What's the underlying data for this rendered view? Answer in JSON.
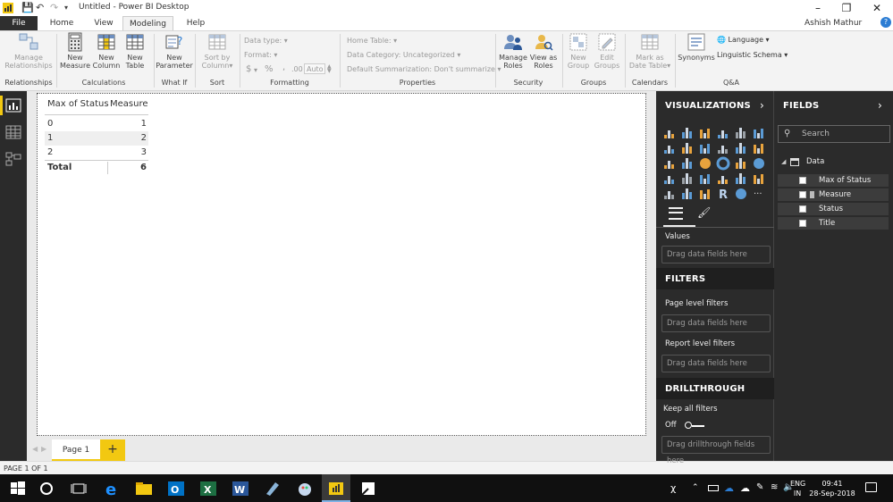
{
  "window": {
    "title": "Untitled - Power BI Desktop",
    "user": "Ashish Mathur"
  },
  "tabs": [
    {
      "label": "File"
    },
    {
      "label": "Home"
    },
    {
      "label": "View"
    },
    {
      "label": "Modeling"
    },
    {
      "label": "Help"
    }
  ],
  "ribbon": {
    "manage_relationships": "Manage\nRelationships",
    "manage_rel_1": "Manage",
    "manage_rel_2": "Relationships",
    "new_measure_1": "New",
    "new_measure_2": "Measure",
    "new_column_1": "New",
    "new_column_2": "Column",
    "new_table_1": "New",
    "new_table_2": "Table",
    "new_parameter_1": "New",
    "new_parameter_2": "Parameter",
    "sort_by_1": "Sort by",
    "sort_by_2": "Column",
    "data_type": "Data type:",
    "format": "Format:",
    "dollar": "$",
    "percent": "%",
    "comma": ",",
    "auto": "Auto",
    "home_table": "Home Table:",
    "data_category": "Data Category: Uncategorized",
    "default_summarization": "Default Summarization: Don't summarize",
    "manage_roles_1": "Manage",
    "manage_roles_2": "Roles",
    "view_as_1": "View as",
    "view_as_2": "Roles",
    "new_group_1": "New",
    "new_group_2": "Group",
    "edit_groups_1": "Edit",
    "edit_groups_2": "Groups",
    "mark_date_1": "Mark as",
    "mark_date_2": "Date Table",
    "synonyms": "Synonyms",
    "language": "Language",
    "linguistic_schema": "Linguistic Schema",
    "groups": {
      "relationships": "Relationships",
      "calculations": "Calculations",
      "what_if": "What If",
      "sort": "Sort",
      "formatting": "Formatting",
      "properties": "Properties",
      "security": "Security",
      "groups": "Groups",
      "calendars": "Calendars",
      "qa": "Q&A"
    }
  },
  "table": {
    "headers": [
      "Max of Status",
      "Measure"
    ],
    "rows": [
      [
        "0",
        "1"
      ],
      [
        "1",
        "2"
      ],
      [
        "2",
        "3"
      ]
    ],
    "total_label": "Total",
    "total_value": "6"
  },
  "pages": {
    "tab": "Page 1",
    "add": "+",
    "status": "PAGE 1 OF 1"
  },
  "visualizations": {
    "title": "VISUALIZATIONS",
    "values_label": "Values",
    "values_drop": "Drag data fields here"
  },
  "filters": {
    "title": "FILTERS",
    "page_level": "Page level filters",
    "page_drop": "Drag data fields here",
    "report_level": "Report level filters",
    "report_drop": "Drag data fields here"
  },
  "drillthrough": {
    "title": "DRILLTHROUGH",
    "keep_all": "Keep all filters",
    "toggle": "Off",
    "drop": "Drag drillthrough fields here"
  },
  "fields": {
    "title": "FIELDS",
    "search_placeholder": "Search",
    "table_name": "Data",
    "items": [
      {
        "label": "Max of Status"
      },
      {
        "label": "Measure"
      },
      {
        "label": "Status"
      },
      {
        "label": "Title"
      }
    ]
  },
  "taskbar": {
    "lang1": "ENG",
    "lang2": "IN",
    "time": "09:41",
    "date": "28-Sep-2018"
  },
  "colors": {
    "accent": "#f2c811",
    "pane_bg": "#2b2b2b",
    "ribbon_bg": "#f3f3f3"
  }
}
